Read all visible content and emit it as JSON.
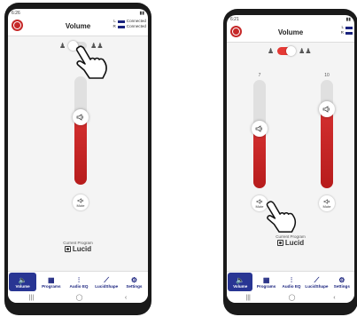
{
  "phone1": {
    "status_time": "6:26",
    "status_icons": "▮▮",
    "title": "Volume",
    "connection": {
      "left_label": "L",
      "left_status": "Connected",
      "right_label": "R",
      "right_status": "Connected"
    },
    "split_toggle_on": false,
    "master_level_fraction": 0.62,
    "mute_label": "Mute",
    "program_caption": "Current Program",
    "program_name": "Lucid"
  },
  "phone2": {
    "status_time": "6:21",
    "status_icons": "▮▮",
    "title": "Volume",
    "connection": {
      "left_label": "L",
      "left_status": "",
      "right_label": "R",
      "right_status": ""
    },
    "split_toggle_on": true,
    "left_level_value": "7",
    "left_level_fraction": 0.55,
    "right_level_value": "10",
    "right_level_fraction": 0.73,
    "left_mute_label": "Mute",
    "right_mute_label": "Mute",
    "program_caption": "Current Program",
    "program_name": "Lucid"
  },
  "nav": [
    {
      "label": "Volume",
      "icon": "speaker-icon",
      "glyph": "🔈"
    },
    {
      "label": "Programs",
      "icon": "grid-icon",
      "glyph": "▦"
    },
    {
      "label": "Audio EQ",
      "icon": "equalizer-icon",
      "glyph": "⫶"
    },
    {
      "label": "LucidShape",
      "icon": "chart-icon",
      "glyph": "⟋"
    },
    {
      "label": "Settings",
      "icon": "gear-icon",
      "glyph": "⚙"
    }
  ],
  "system_nav": {
    "recents": "|||",
    "home": "◯",
    "back": "‹"
  },
  "colors": {
    "accent": "#d32f2f",
    "nav_active": "#283593",
    "brand": "#c62828"
  }
}
